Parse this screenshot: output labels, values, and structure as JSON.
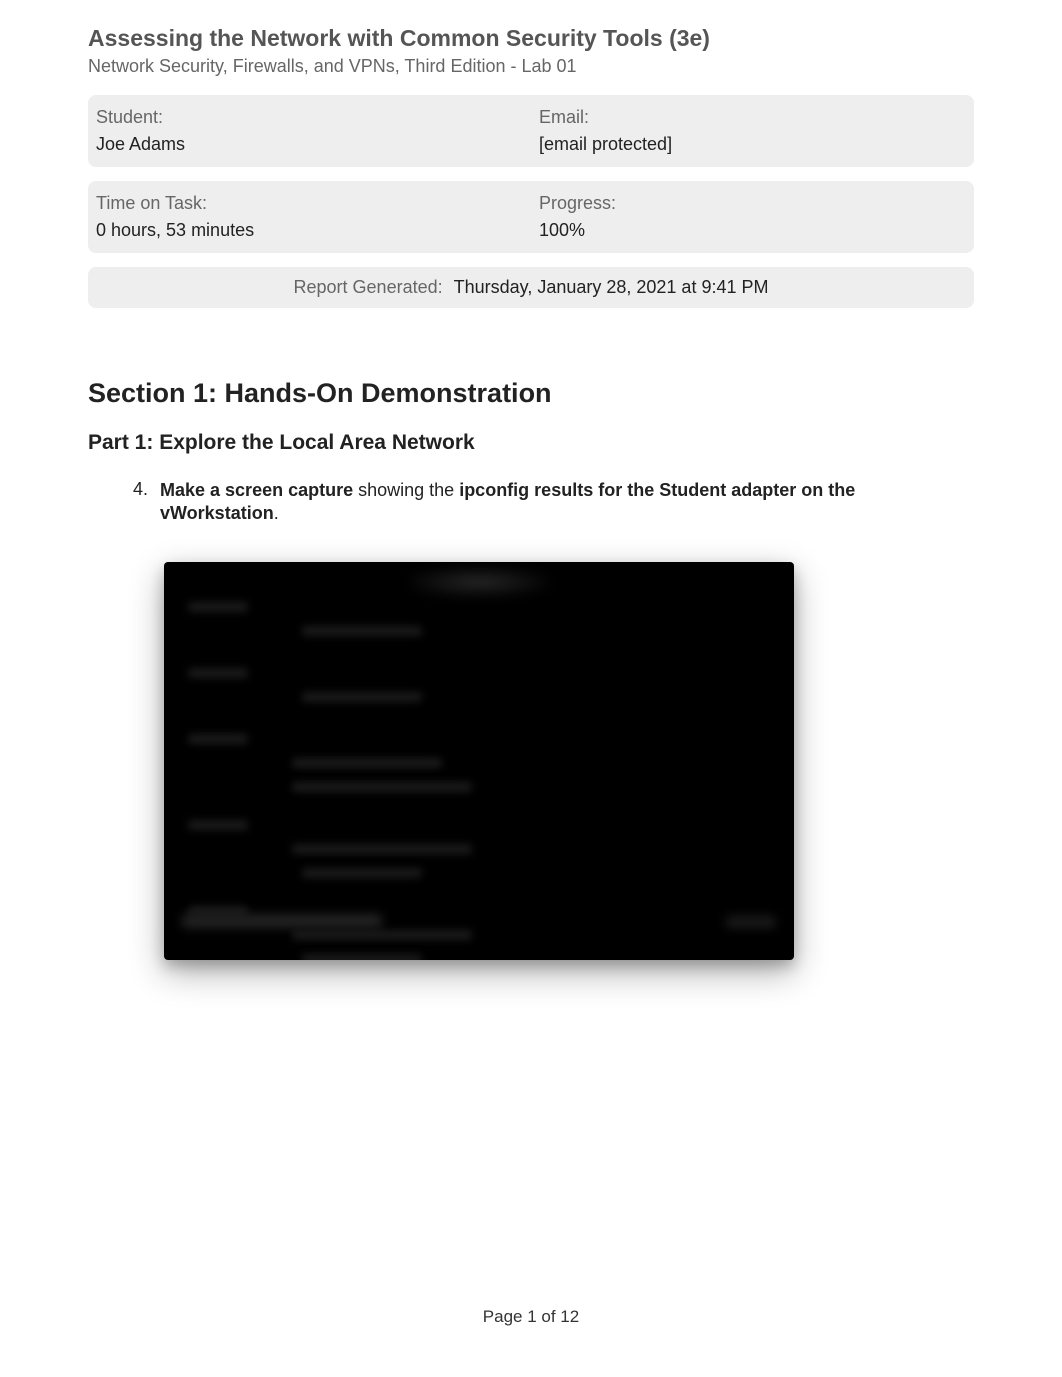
{
  "header": {
    "title": "Assessing the Network with Common Security Tools (3e)",
    "subtitle": "Network Security, Firewalls, and VPNs, Third Edition - Lab 01"
  },
  "info": {
    "student_label": "Student:",
    "student_value": "Joe Adams",
    "email_label": "Email:",
    "email_value": "[email protected]",
    "time_label": "Time on Task:",
    "time_value": "0 hours, 53 minutes",
    "progress_label": "Progress:",
    "progress_value": "100%"
  },
  "report": {
    "label": "Report Generated:",
    "value": "Thursday, January 28, 2021 at 9:41 PM"
  },
  "section": {
    "heading": "Section 1: Hands-On Demonstration",
    "part": "Part 1: Explore the Local Area Network"
  },
  "task": {
    "number": "4.",
    "seg1": "Make a screen capture",
    "seg2": " showing the ",
    "seg3": "ipconfig results for the Student adapter on the vWorkstation",
    "seg4": "."
  },
  "footer": {
    "page": "Page 1 of 12"
  }
}
